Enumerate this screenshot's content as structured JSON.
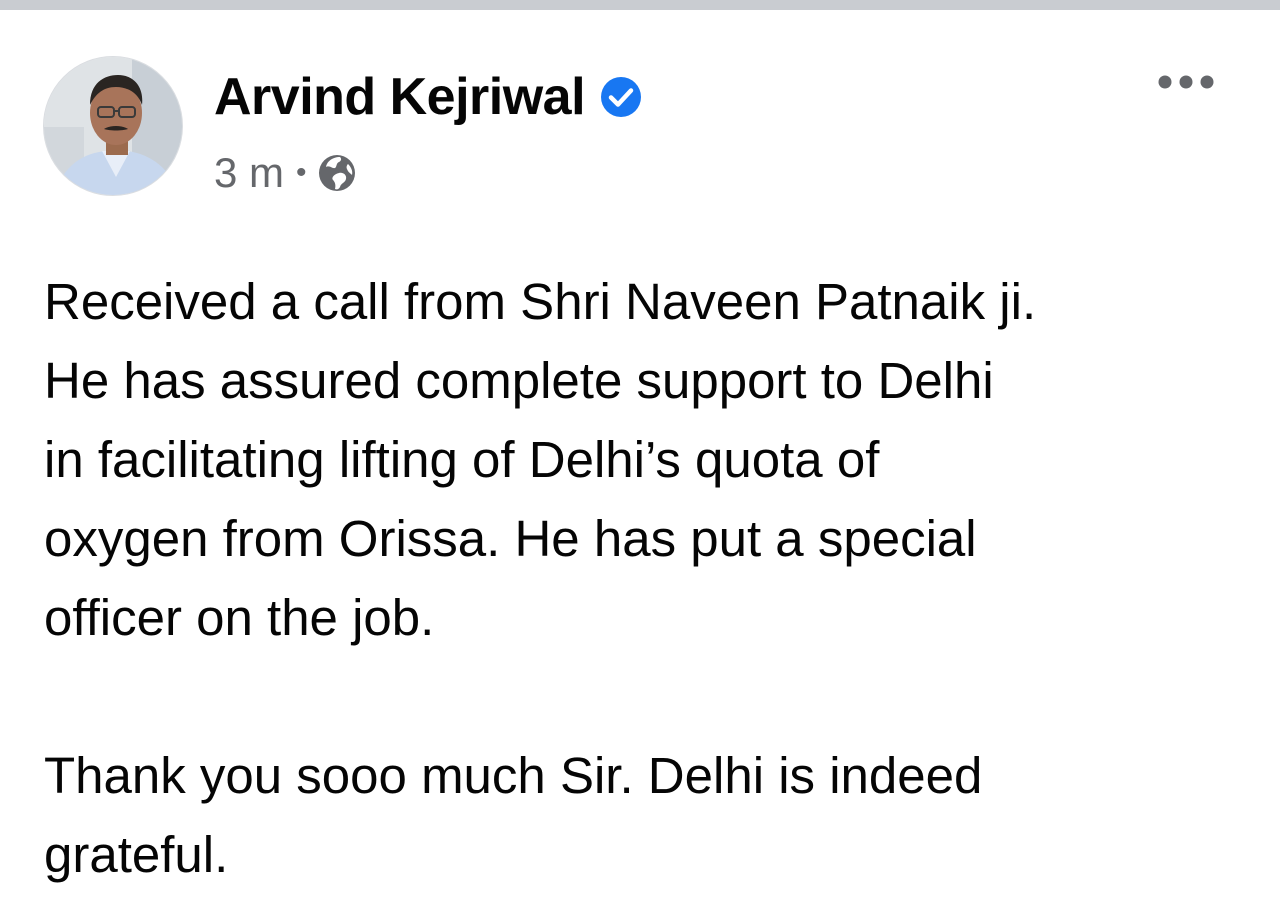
{
  "post": {
    "author": "Arvind Kejriwal",
    "timestamp": "3 m",
    "separator": "•",
    "audience_icon": "globe-icon",
    "verified_icon": "verified-badge-icon",
    "menu_icon": "more-options-icon",
    "paragraphs": [
      "Received a call from Shri Naveen Patnaik ji.\nHe has assured complete support to Delhi\nin facilitating lifting of Delhi’s quota of\noxygen from Orissa. He has put a special\nofficer on the job.",
      "Thank you sooo much Sir. Delhi is indeed\ngrateful."
    ]
  },
  "colors": {
    "text_primary": "#050505",
    "text_secondary": "#65676b",
    "verified_blue": "#1877f2",
    "top_strip": "#c9ccd1"
  }
}
